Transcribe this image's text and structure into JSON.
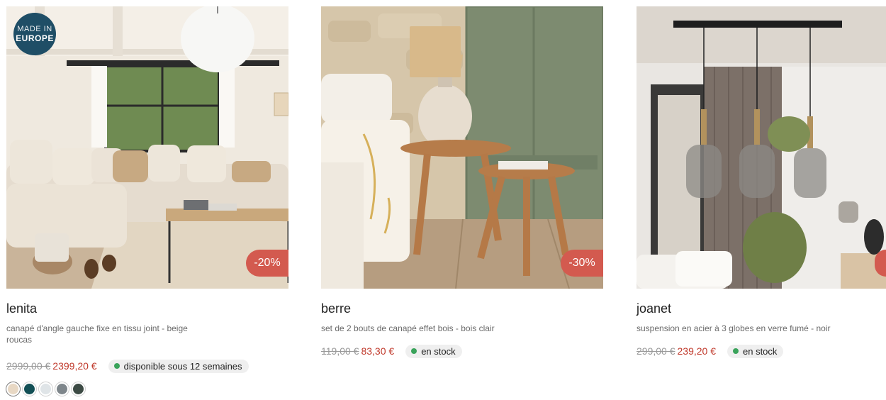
{
  "products": [
    {
      "name": "lenita",
      "description": "canapé d'angle gauche fixe en tissu joint - beige roucas",
      "old_price": "2999,00 €",
      "new_price": "2399,20 €",
      "availability": "disponible sous 12 semaines",
      "discount": "-20%",
      "badge_line1": "MADE IN",
      "badge_line2": "EUROPE",
      "swatches": [
        "#e8d8c4",
        "#124f55",
        "#dfe4e7",
        "#7e868b",
        "#3c4a44"
      ]
    },
    {
      "name": "berre",
      "description": "set de 2 bouts de canapé effet bois - bois clair",
      "old_price": "119,00 €",
      "new_price": "83,30 €",
      "availability": "en stock",
      "discount": "-30%"
    },
    {
      "name": "joanet",
      "description": "suspension en acier à 3 globes en verre fumé - noir",
      "old_price": "299,00 €",
      "new_price": "239,20 €",
      "availability": "en stock",
      "discount": ""
    }
  ],
  "colors": {
    "discount_bg": "#d35a4f",
    "new_price": "#c0392b",
    "stock_dot": "#3aa35b",
    "badge_bg": "#1f4e66"
  }
}
